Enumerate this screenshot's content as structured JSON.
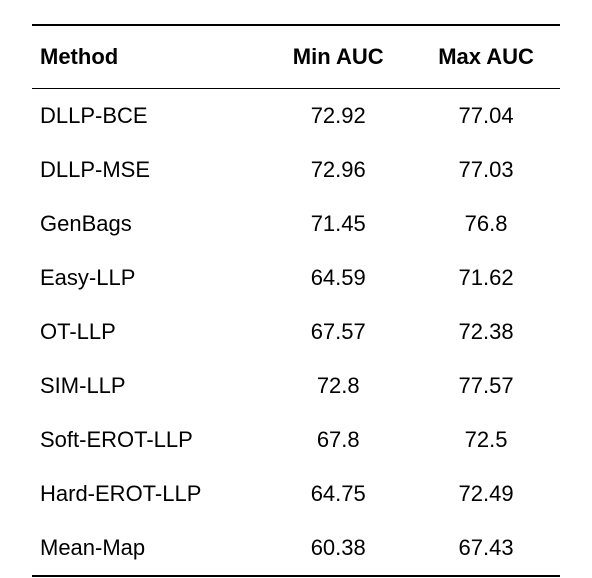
{
  "headers": {
    "method": "Method",
    "min_auc": "Min AUC",
    "max_auc": "Max AUC"
  },
  "rows": [
    {
      "method": "DLLP-BCE",
      "min_auc": "72.92",
      "max_auc": "77.04"
    },
    {
      "method": "DLLP-MSE",
      "min_auc": "72.96",
      "max_auc": "77.03"
    },
    {
      "method": "GenBags",
      "min_auc": "71.45",
      "max_auc": "76.8"
    },
    {
      "method": "Easy-LLP",
      "min_auc": "64.59",
      "max_auc": "71.62"
    },
    {
      "method": "OT-LLP",
      "min_auc": "67.57",
      "max_auc": "72.38"
    },
    {
      "method": "SIM-LLP",
      "min_auc": "72.8",
      "max_auc": "77.57"
    },
    {
      "method": "Soft-EROT-LLP",
      "min_auc": "67.8",
      "max_auc": "72.5"
    },
    {
      "method": "Hard-EROT-LLP",
      "min_auc": "64.75",
      "max_auc": "72.49"
    },
    {
      "method": "Mean-Map",
      "min_auc": "60.38",
      "max_auc": "67.43"
    }
  ],
  "chart_data": {
    "type": "table",
    "title": "",
    "columns": [
      "Method",
      "Min AUC",
      "Max AUC"
    ],
    "rows": [
      [
        "DLLP-BCE",
        72.92,
        77.04
      ],
      [
        "DLLP-MSE",
        72.96,
        77.03
      ],
      [
        "GenBags",
        71.45,
        76.8
      ],
      [
        "Easy-LLP",
        64.59,
        71.62
      ],
      [
        "OT-LLP",
        67.57,
        72.38
      ],
      [
        "SIM-LLP",
        72.8,
        77.57
      ],
      [
        "Soft-EROT-LLP",
        67.8,
        72.5
      ],
      [
        "Hard-EROT-LLP",
        64.75,
        72.49
      ],
      [
        "Mean-Map",
        60.38,
        67.43
      ]
    ]
  }
}
